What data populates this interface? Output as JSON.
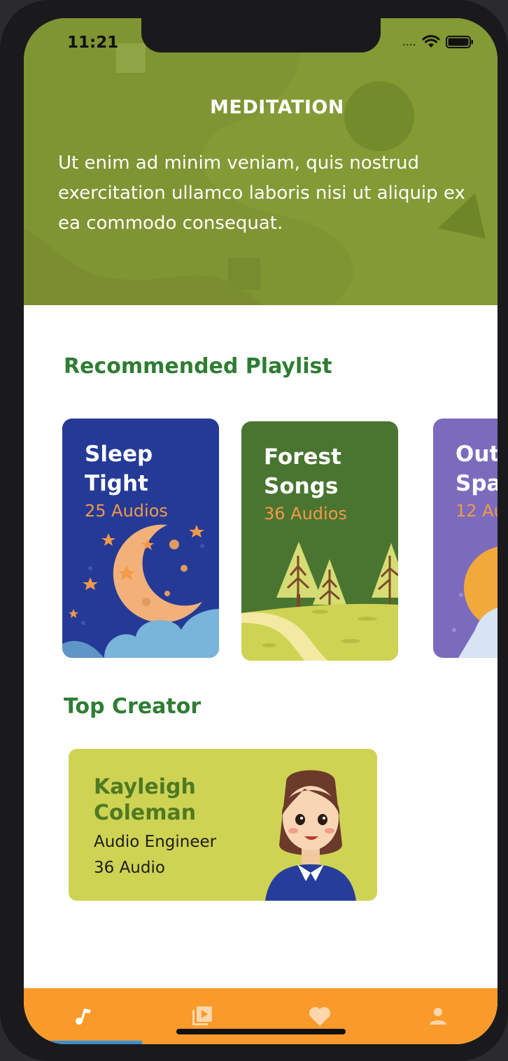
{
  "status_bar": {
    "time": "11:21",
    "signal": "....",
    "icons": [
      "wifi-icon",
      "battery-icon"
    ]
  },
  "header": {
    "title": "MEDITATION",
    "description": "Ut enim ad minim veniam, quis nostrud exercitation ullamco laboris nisi ut aliquip ex ea commodo consequat.",
    "color": "#839a35"
  },
  "recommended": {
    "title": "Recommended Playlist",
    "cards": [
      {
        "title": "Sleep\nTight",
        "count": "25 Audios",
        "color": "#253a97",
        "art": "moon-clouds"
      },
      {
        "title": "Forest\nSongs",
        "count": "36 Audios",
        "color": "#4a7530",
        "art": "forest-trees"
      },
      {
        "title": "Out\nSpa",
        "count": "12 Au",
        "color": "#7b6bbd",
        "art": "outer-space"
      }
    ]
  },
  "top_creator": {
    "title": "Top Creator",
    "name": "Kayleigh\nColeman",
    "role": "Audio Engineer",
    "count": "36 Audio",
    "color": "#cfd353"
  },
  "tabbar": {
    "color": "#f99a2a",
    "tabs": [
      {
        "icon": "music-note-icon",
        "active": true
      },
      {
        "icon": "video-library-icon",
        "active": false
      },
      {
        "icon": "heart-icon",
        "active": false
      },
      {
        "icon": "person-icon",
        "active": false
      }
    ]
  }
}
